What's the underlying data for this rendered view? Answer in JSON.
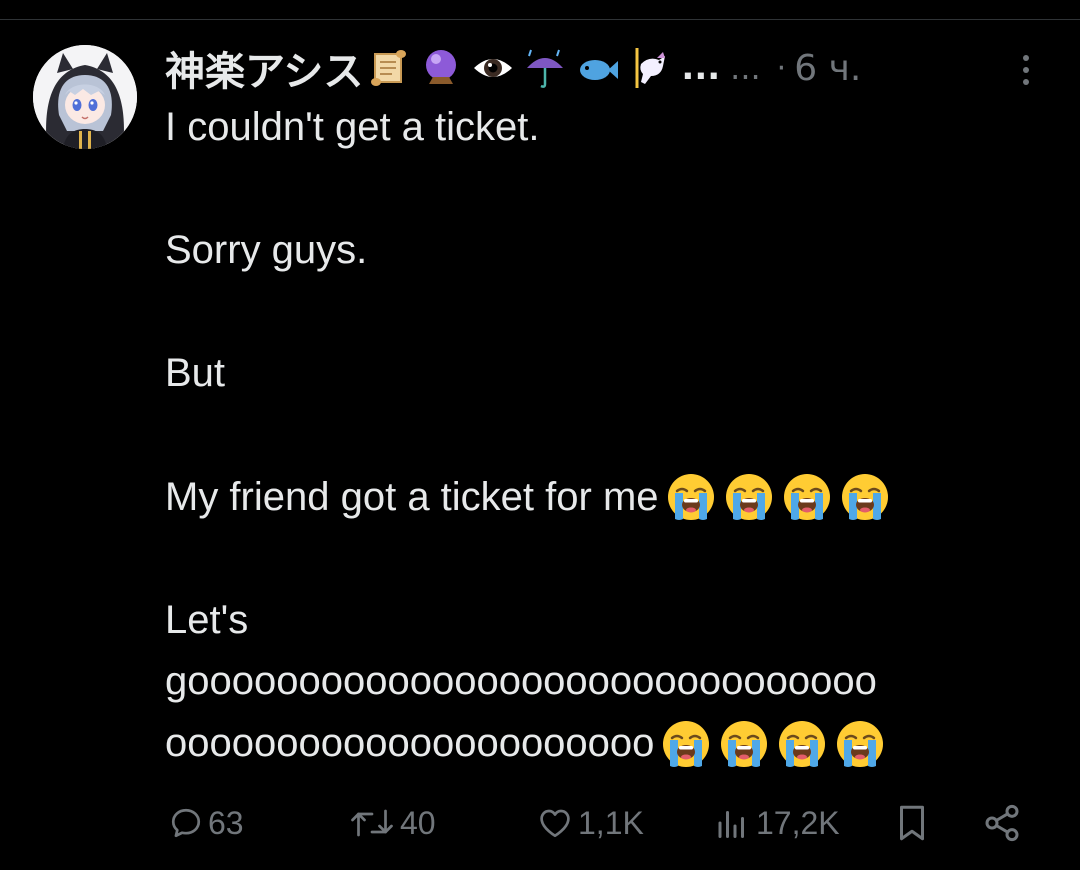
{
  "post": {
    "author": {
      "display_name": "神楽アシス",
      "name_emojis": [
        "scroll",
        "crystal-ball",
        "eye",
        "umbrella-with-rain",
        "fish",
        "carousel-horse"
      ],
      "truncation_bold": "...",
      "truncation_soft": "...",
      "avatar_description": "anime girl avatar"
    },
    "separator": "·",
    "time": "6 ч.",
    "text_lines": [
      {
        "text": "I couldn't get a ticket.",
        "emojis": 0
      },
      {
        "text": "",
        "emojis": 0
      },
      {
        "text": "Sorry guys.",
        "emojis": 0
      },
      {
        "text": "",
        "emojis": 0
      },
      {
        "text": "But",
        "emojis": 0
      },
      {
        "text": "",
        "emojis": 0
      },
      {
        "text": "My friend got a ticket for me",
        "emojis": 4
      },
      {
        "text": "",
        "emojis": 0
      },
      {
        "text": "Let's",
        "emojis": 0
      },
      {
        "text": "gooooooooooooooooooooooooooooooo",
        "emojis": 0
      },
      {
        "text": "oooooooooooooooooooooo",
        "emojis": 4
      }
    ],
    "emoji_name": "loudly-crying-face"
  },
  "actions": {
    "replies": "63",
    "reposts": "40",
    "likes": "1,1K",
    "views": "17,2K"
  },
  "colors": {
    "background": "#000000",
    "text": "#e7e9ea",
    "muted": "#71767b",
    "divider": "#2f3336"
  }
}
